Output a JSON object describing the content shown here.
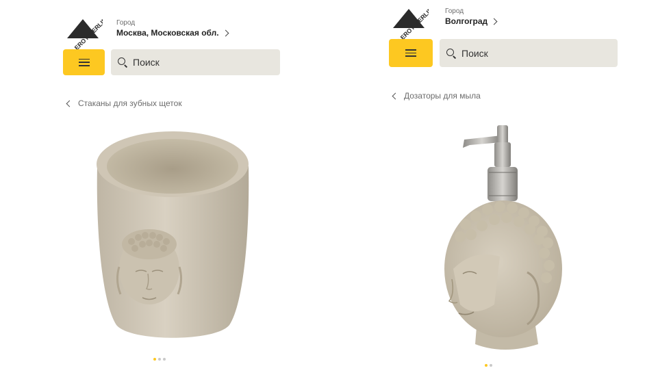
{
  "colors": {
    "accent": "#fdc821",
    "search_bg": "#e8e6df",
    "logo": "#2b2b2b"
  },
  "left": {
    "logo_text": "LEROY MERLIN",
    "city_label": "Город",
    "city_value": "Москва, Московская обл.",
    "search_placeholder": "Поиск",
    "breadcrumb": "Стаканы для зубных щеток",
    "gallery": {
      "total": 3,
      "active": 1
    }
  },
  "right": {
    "logo_text": "LEROY MERLIN",
    "city_label": "Город",
    "city_value": "Волгоград",
    "search_placeholder": "Поиск",
    "breadcrumb": "Дозаторы для мыла",
    "gallery": {
      "total": 2,
      "active": 1
    }
  },
  "icons": [
    "leroy-merlin-logo",
    "chevron-right-icon",
    "menu-icon",
    "search-icon",
    "chevron-left-icon"
  ]
}
